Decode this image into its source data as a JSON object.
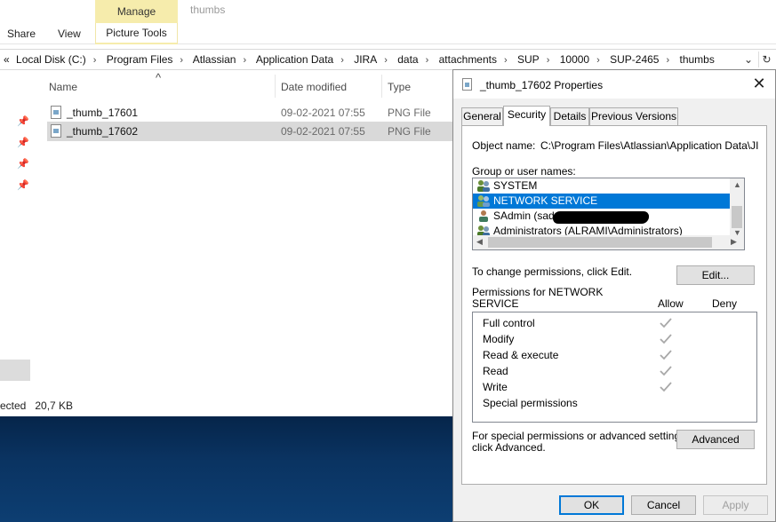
{
  "ribbon": {
    "context_header": "Manage",
    "context_title": "thumbs",
    "tabs": {
      "share": "Share",
      "view": "View",
      "picture_tools": "Picture Tools"
    }
  },
  "address": {
    "nav_left": "«",
    "crumbs": [
      "Local Disk (C:)",
      "Program Files",
      "Atlassian",
      "Application Data",
      "JIRA",
      "data",
      "attachments",
      "SUP",
      "10000",
      "SUP-2465",
      "thumbs"
    ],
    "separator": "›",
    "dropdown_glyph": "⌄",
    "refresh_glyph": "↻"
  },
  "file_list": {
    "sort_glyph": "^",
    "columns": {
      "name": "Name",
      "date": "Date modified",
      "type": "Type"
    },
    "rows": [
      {
        "name": "_thumb_17601",
        "date": "09-02-2021 07:55",
        "type": "PNG File"
      },
      {
        "name": "_thumb_17602",
        "date": "09-02-2021 07:55",
        "type": "PNG File"
      }
    ]
  },
  "status_bar": {
    "text": "ected   20,7 KB"
  },
  "nav_pin_glyph": "📌",
  "dialog": {
    "title": "_thumb_17602 Properties",
    "close_glyph": "✕",
    "tabs": {
      "general": "General",
      "security": "Security",
      "details": "Details",
      "previous": "Previous Versions"
    },
    "object_name_label": "Object name:",
    "object_name_value": "C:\\Program Files\\Atlassian\\Application Data\\JIRA\\",
    "group_label": "Group or user names:",
    "groups": {
      "system": "SYSTEM",
      "network": "NETWORK SERVICE",
      "sadmin": "SAdmin (sadmin",
      "admins": "Administrators (ALRAMI\\Administrators)"
    },
    "change_text": "To change permissions, click Edit.",
    "edit_button": "Edit...",
    "perms_for": "Permissions for NETWORK",
    "perms_for_2": "SERVICE",
    "allow_label": "Allow",
    "deny_label": "Deny",
    "permissions": {
      "full": "Full control",
      "modify": "Modify",
      "readexec": "Read & execute",
      "read": "Read",
      "write": "Write",
      "special": "Special permissions"
    },
    "special_text_1": "For special permissions or advanced settings,",
    "special_text_2": "click Advanced.",
    "advanced_button": "Advanced",
    "ok": "OK",
    "cancel": "Cancel",
    "apply": "Apply"
  },
  "colors": {
    "selection": "#0078d7",
    "manage_tab": "#f6ecac",
    "desktop": "#0a3361"
  }
}
